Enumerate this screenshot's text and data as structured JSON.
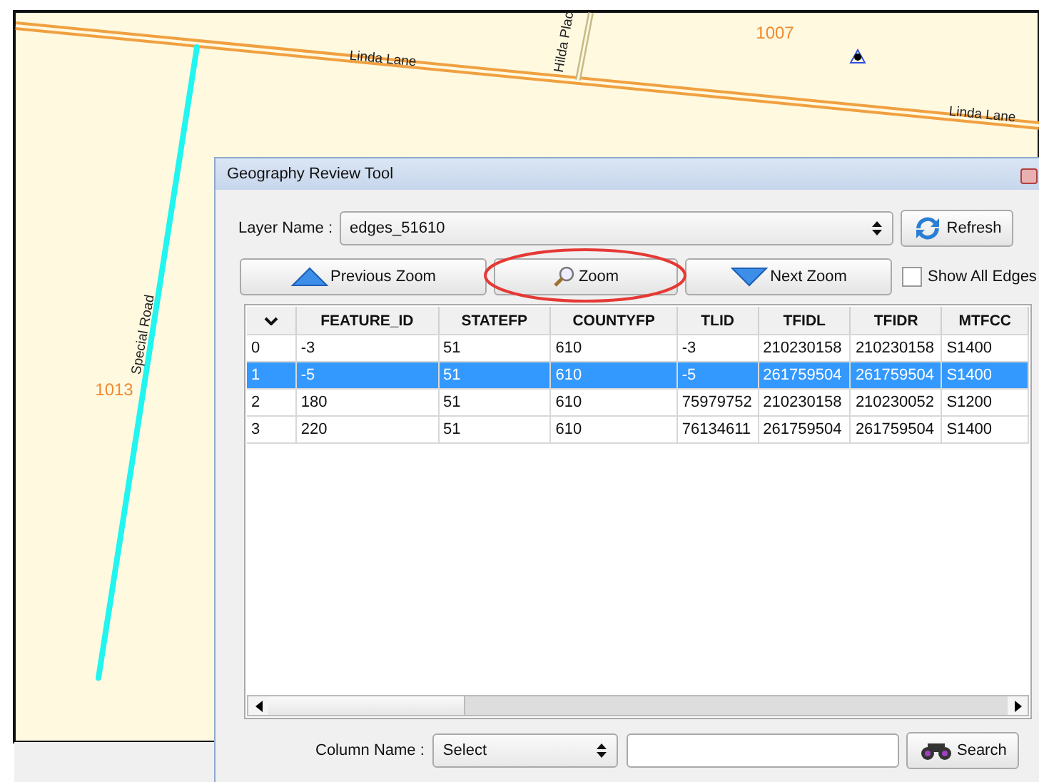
{
  "map": {
    "labels": [
      {
        "text": "Linda Lane",
        "kind": "road"
      },
      {
        "text": "Hilda Plac",
        "kind": "road"
      },
      {
        "text": "1007",
        "kind": "block"
      },
      {
        "text": "Linda Lane",
        "kind": "road"
      },
      {
        "text": "Special Road",
        "kind": "road"
      },
      {
        "text": "1013",
        "kind": "block"
      }
    ]
  },
  "dialog": {
    "title": "Geography Review Tool",
    "layer": {
      "label": "Layer Name :",
      "value": "edges_51610",
      "button": "Refresh"
    },
    "zoom_buttons": [
      {
        "label": "Previous Zoom",
        "kind": "previous",
        "highlighted": false
      },
      {
        "label": "Zoom",
        "kind": "zoom",
        "highlighted": true
      },
      {
        "label": "Next Zoom",
        "kind": "next",
        "highlighted": false
      }
    ],
    "show_all_edges": {
      "label": "Show All Edges",
      "checked": false
    },
    "table": {
      "columns": [
        "FEATURE_ID",
        "STATEFP",
        "COUNTYFP",
        "TLID",
        "TFIDL",
        "TFIDR",
        "MTFCC"
      ],
      "rows": [
        {
          "index": "0",
          "cells": [
            "-3",
            "51",
            "610",
            "-3",
            "210230158",
            "210230158",
            "S1400"
          ],
          "selected": false
        },
        {
          "index": "1",
          "cells": [
            "-5",
            "51",
            "610",
            "-5",
            "261759504",
            "261759504",
            "S1400"
          ],
          "selected": true
        },
        {
          "index": "2",
          "cells": [
            "180",
            "51",
            "610",
            "75979752",
            "210230158",
            "210230052",
            "S1200"
          ],
          "selected": false
        },
        {
          "index": "3",
          "cells": [
            "220",
            "51",
            "610",
            "76134611",
            "261759504",
            "261759504",
            "S1400"
          ],
          "selected": false
        }
      ]
    },
    "search": {
      "label": "Column Name :",
      "select": "Select",
      "button": "Search"
    }
  }
}
